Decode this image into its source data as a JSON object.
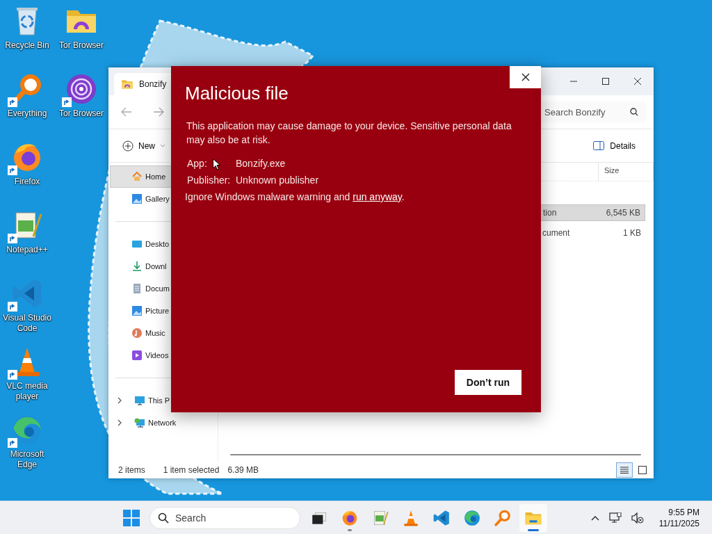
{
  "desktop": {
    "icons": [
      {
        "label": "Recycle Bin",
        "kind": "recycle",
        "shortcut": false
      },
      {
        "label": "Tor Browser",
        "kind": "torfolder",
        "shortcut": false
      },
      {
        "label": "Everything",
        "kind": "everything",
        "shortcut": true
      },
      {
        "label": "Tor Browser",
        "kind": "tor",
        "shortcut": true
      },
      {
        "label": "Firefox",
        "kind": "firefox",
        "shortcut": true
      },
      {
        "label": "Notepad++",
        "kind": "notepad",
        "shortcut": true
      },
      {
        "label": "Visual Studio Code",
        "kind": "vscode",
        "shortcut": true
      },
      {
        "label": "VLC media player",
        "kind": "vlc",
        "shortcut": true
      },
      {
        "label": "Microsoft Edge",
        "kind": "edge",
        "shortcut": true
      }
    ]
  },
  "explorer": {
    "tab_title": "Bonzify",
    "search": {
      "placeholder": "Search Bonzify"
    },
    "toolbar": {
      "new": "New",
      "details": "Details"
    },
    "sidebar": [
      [
        {
          "label": "Home",
          "kind": "home",
          "selected": true
        },
        {
          "label": "Gallery",
          "kind": "gallery",
          "selected": false
        }
      ],
      [
        {
          "label": "Deskto",
          "kind": "desktop",
          "selected": false
        },
        {
          "label": "Downl",
          "kind": "downloads",
          "selected": false
        },
        {
          "label": "Docum",
          "kind": "documents",
          "selected": false
        },
        {
          "label": "Picture",
          "kind": "pictures",
          "selected": false
        },
        {
          "label": "Music",
          "kind": "music",
          "selected": false
        },
        {
          "label": "Videos",
          "kind": "videos",
          "selected": false
        }
      ],
      [
        {
          "label": "This P",
          "kind": "pc",
          "selected": false,
          "expanded": false
        },
        {
          "label": "Network",
          "kind": "network",
          "selected": false,
          "expanded": false
        }
      ]
    ],
    "columns": [
      "Size"
    ],
    "rows": [
      {
        "name": "tion",
        "size": "6,545 KB",
        "selected": true
      },
      {
        "name": "cument",
        "size": "1 KB",
        "selected": false
      }
    ],
    "status": {
      "count": "2 items",
      "selection": "1 item selected",
      "size": "6.39 MB"
    },
    "views": [
      {
        "kind": "details",
        "selected": true
      },
      {
        "kind": "tiles",
        "selected": false
      }
    ]
  },
  "dialog": {
    "title": "Malicious file",
    "message": "This application may cause damage to your device. Sensitive personal data may also be at risk.",
    "fields": [
      {
        "label": "App:",
        "value": "Bonzify.exe"
      },
      {
        "label": "Publisher:",
        "value": "Unknown publisher"
      }
    ],
    "warning": "Ignore Windows malware warning and",
    "link": "run anyway",
    "warning_end": ".",
    "button": "Don’t run"
  },
  "taskbar": {
    "search": {
      "placeholder": "Search"
    },
    "apps": [
      {
        "kind": "taskview",
        "running": false,
        "selected": false
      },
      {
        "kind": "firefox",
        "running": true,
        "selected": false
      },
      {
        "kind": "notepad",
        "running": false,
        "selected": false
      },
      {
        "kind": "vlc",
        "running": false,
        "selected": false
      },
      {
        "kind": "vscode",
        "running": false,
        "selected": false
      },
      {
        "kind": "edge",
        "running": false,
        "selected": false
      },
      {
        "kind": "everything",
        "running": false,
        "selected": false
      },
      {
        "kind": "explorer",
        "running": true,
        "selected": true
      }
    ],
    "time": "9:55 PM",
    "date": "11/11/2025"
  }
}
